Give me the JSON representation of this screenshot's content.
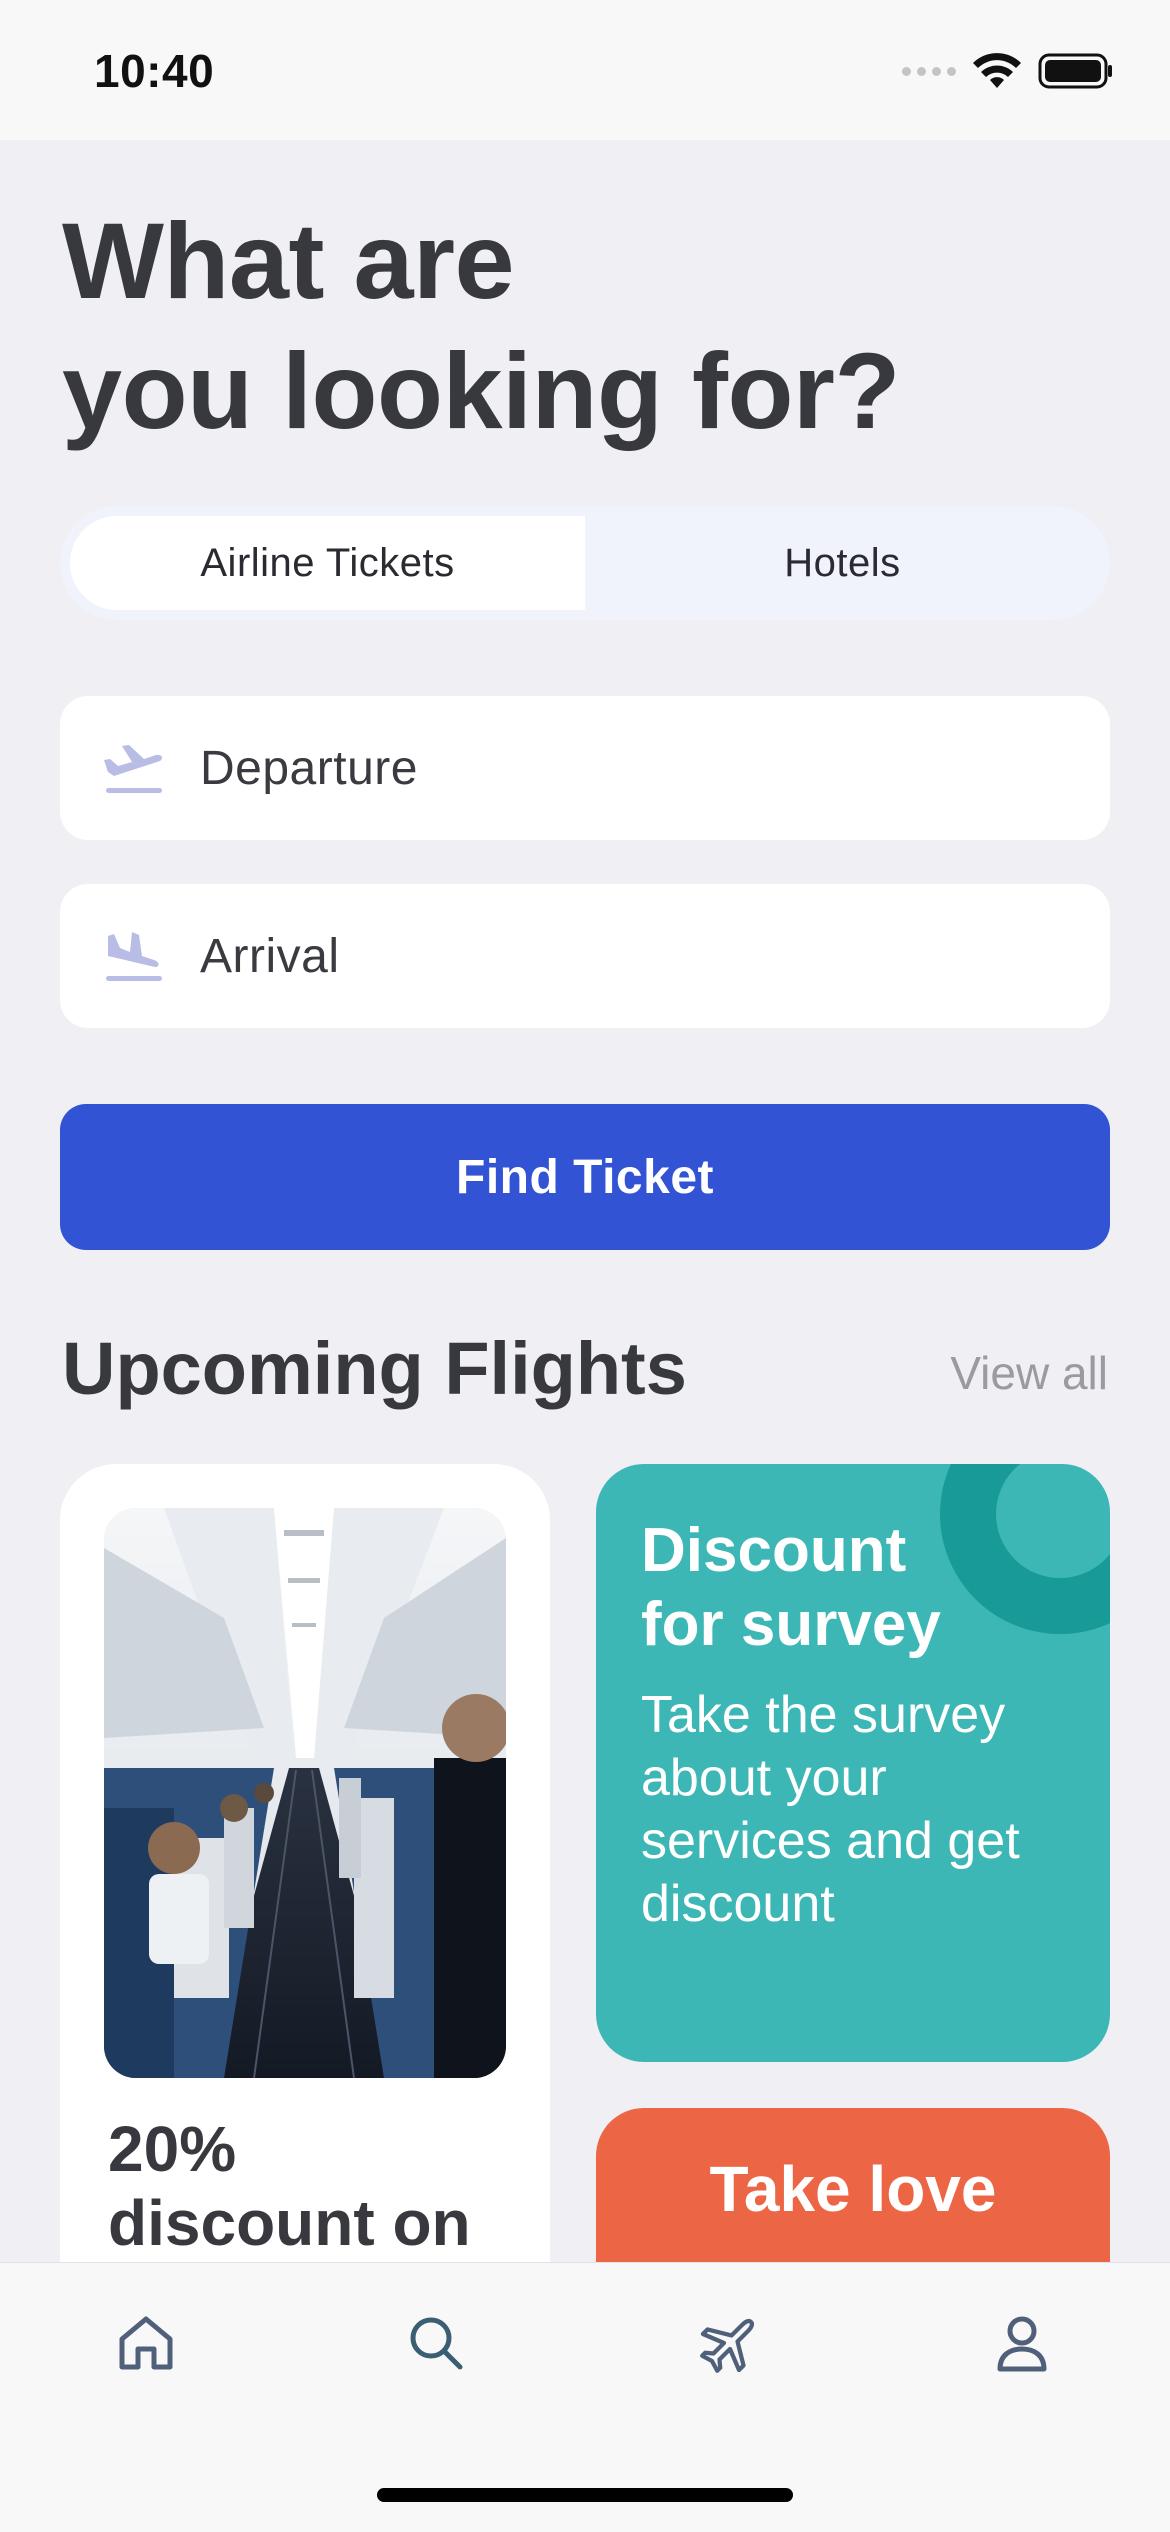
{
  "status_bar": {
    "time": "10:40"
  },
  "title": {
    "line1": "What are",
    "line2": "you looking for?"
  },
  "segments": [
    {
      "label": "Airline Tickets",
      "selected": true
    },
    {
      "label": "Hotels",
      "selected": false
    }
  ],
  "fields": {
    "departure": {
      "placeholder": "Departure",
      "icon": "plane-takeoff-icon"
    },
    "arrival": {
      "placeholder": "Arrival",
      "icon": "plane-landing-icon"
    }
  },
  "find_button": {
    "label": "Find Ticket",
    "color": "#3153d4"
  },
  "upcoming": {
    "title": "Upcoming Flights",
    "view_all": "View all"
  },
  "cards": {
    "promo": {
      "line1": "20%",
      "line2": "discount on",
      "image": "airplane-cabin-aisle-photo"
    },
    "survey": {
      "title_line1": "Discount",
      "title_line2": "for survey",
      "body": "Take the survey about your services and get discount",
      "color": "#3db7b5"
    },
    "love": {
      "title": "Take love",
      "color": "#ec6645"
    }
  },
  "tab_bar": [
    {
      "name": "home",
      "icon": "home-icon",
      "active": false
    },
    {
      "name": "search",
      "icon": "search-icon",
      "active": true
    },
    {
      "name": "flights",
      "icon": "airplane-icon",
      "active": false
    },
    {
      "name": "profile",
      "icon": "user-icon",
      "active": false
    }
  ]
}
